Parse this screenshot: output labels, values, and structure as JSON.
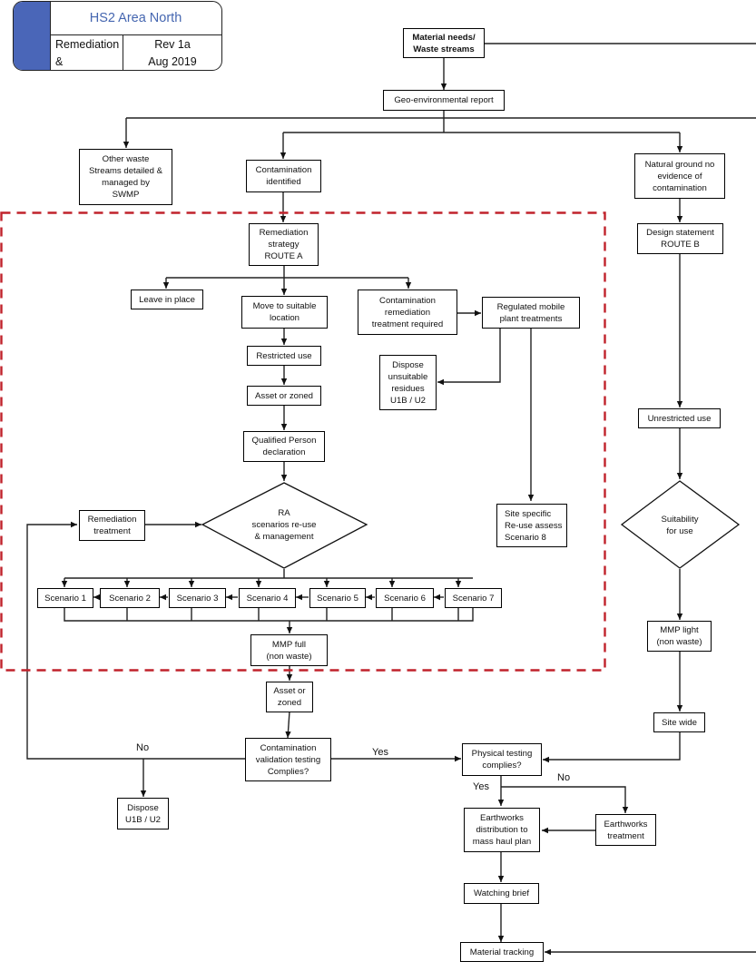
{
  "title_block": {
    "heading": "HS2 Area North",
    "subtitle": "Remediation &\nMMP process",
    "revision": "Rev 1a\nAug 2019",
    "accent_color": "#4a66b8",
    "heading_color": "#4566b0"
  },
  "nodes": {
    "material_needs": "Material needs/\nWaste streams",
    "geo_report": "Geo-environmental report",
    "other_waste": "Other waste\nStreams detailed &\nmanaged by\nSWMP",
    "contamination_identified": "Contamination\nidentified",
    "natural_ground": "Natural ground no\nevidence of\ncontamination",
    "remediation_strategy": "Remediation\nstrategy\nROUTE A",
    "design_statement": "Design statement\nROUTE B",
    "leave_in_place": "Leave in place",
    "move_suitable": "Move to suitable\nlocation",
    "contamination_remediation": "Contamination\nremediation\ntreatment required",
    "regulated_mobile": "Regulated mobile\nplant treatments",
    "restricted_use": "Restricted use",
    "dispose_residues": "Dispose\nunsuitable\nresidues\nU1B / U2",
    "asset_zoned_1": "Asset or zoned",
    "qualified_person": "Qualified Person\ndeclaration",
    "unrestricted_use": "Unrestricted use",
    "remediation_treatment": "Remediation\ntreatment",
    "ra_scenarios": "RA\nscenarios re-use\n& management",
    "site_specific": "Site specific\nRe-use assess\nScenario 8",
    "suitability": "Suitability\nfor use",
    "scenarios": [
      "Scenario 1",
      "Scenario 2",
      "Scenario 3",
      "Scenario 4",
      "Scenario 5",
      "Scenario 6",
      "Scenario 7"
    ],
    "mmp_full": "MMP full\n(non waste)",
    "mmp_light": "MMP light\n(non waste)",
    "asset_zoned_2": "Asset or\nzoned",
    "site_wide": "Site wide",
    "contamination_validation": "Contamination\nvalidation testing\nComplies?",
    "physical_testing": "Physical testing\ncomplies?",
    "dispose_u1b": "Dispose\nU1B / U2",
    "earthworks_distribution": "Earthworks\ndistribution to\nmass haul plan",
    "earthworks_treatment": "Earthworks\ntreatment",
    "watching_brief": "Watching brief",
    "material_tracking": "Material tracking"
  },
  "edge_labels": {
    "validation_no": "No",
    "validation_yes": "Yes",
    "physical_yes": "Yes",
    "physical_no": "No"
  },
  "colors": {
    "route_a_boundary": "#c0222b",
    "line": "#222222"
  }
}
